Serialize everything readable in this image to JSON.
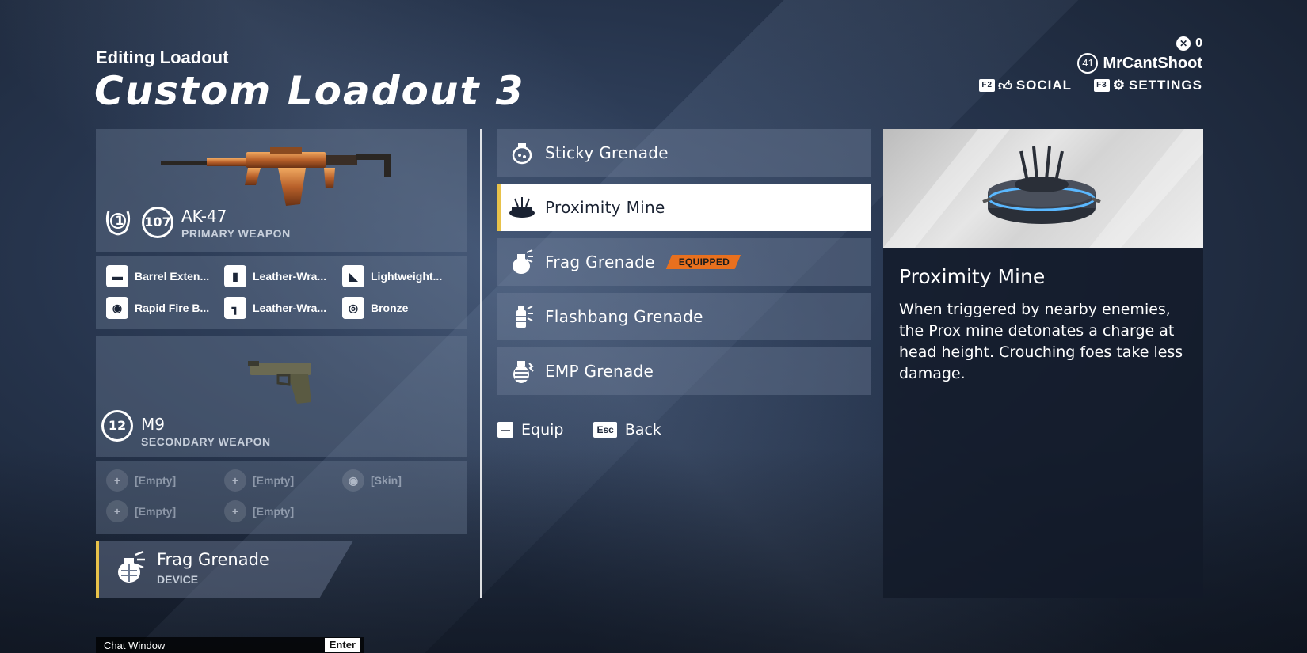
{
  "header": {
    "subtitle": "Editing Loadout",
    "title": "Custom Loadout 3"
  },
  "top_right": {
    "currency_value": "0",
    "player_level": "41",
    "username": "MrCantShoot",
    "social_key": "F2",
    "social_label": "SOCIAL",
    "settings_key": "F3",
    "settings_label": "SETTINGS"
  },
  "primary": {
    "prestige": "1",
    "level": "107",
    "name": "AK-47",
    "type": "PRIMARY WEAPON",
    "attachments": [
      {
        "label": "Barrel Exten...",
        "icon": "barrel-icon"
      },
      {
        "label": "Leather-Wra...",
        "icon": "grip-icon"
      },
      {
        "label": "Lightweight...",
        "icon": "stock-icon"
      },
      {
        "label": "Rapid Fire B...",
        "icon": "target-icon"
      },
      {
        "label": "Leather-Wra...",
        "icon": "pistol-grip-icon"
      },
      {
        "label": "Bronze",
        "icon": "eye-icon"
      }
    ]
  },
  "secondary": {
    "level": "12",
    "name": "M9",
    "type": "SECONDARY WEAPON",
    "attachments": [
      {
        "label": "[Empty]",
        "icon": "plus-icon"
      },
      {
        "label": "[Empty]",
        "icon": "plus-icon"
      },
      {
        "label": "[Skin]",
        "icon": "eye-icon"
      },
      {
        "label": "[Empty]",
        "icon": "plus-icon"
      },
      {
        "label": "[Empty]",
        "icon": "plus-icon"
      }
    ]
  },
  "device": {
    "name": "Frag Grenade",
    "type": "DEVICE"
  },
  "device_list": [
    {
      "label": "Sticky Grenade",
      "icon": "sticky-grenade-icon"
    },
    {
      "label": "Proximity Mine",
      "icon": "proximity-mine-icon",
      "selected": true
    },
    {
      "label": "Frag Grenade",
      "icon": "frag-grenade-icon",
      "badge": "EQUIPPED"
    },
    {
      "label": "Flashbang Grenade",
      "icon": "flashbang-icon"
    },
    {
      "label": "EMP Grenade",
      "icon": "emp-grenade-icon"
    }
  ],
  "hints": {
    "equip_key": "—",
    "equip_label": "Equip",
    "back_key": "Esc",
    "back_label": "Back"
  },
  "detail": {
    "title": "Proximity Mine",
    "description": "When triggered by nearby enemies, the Prox mine detonates a charge at head height. Crouching foes take less damage."
  },
  "chat": {
    "label": "Chat Window",
    "key": "Enter"
  },
  "colors": {
    "accent_yellow": "#e8c24a",
    "equipped_orange": "#e8701e"
  }
}
